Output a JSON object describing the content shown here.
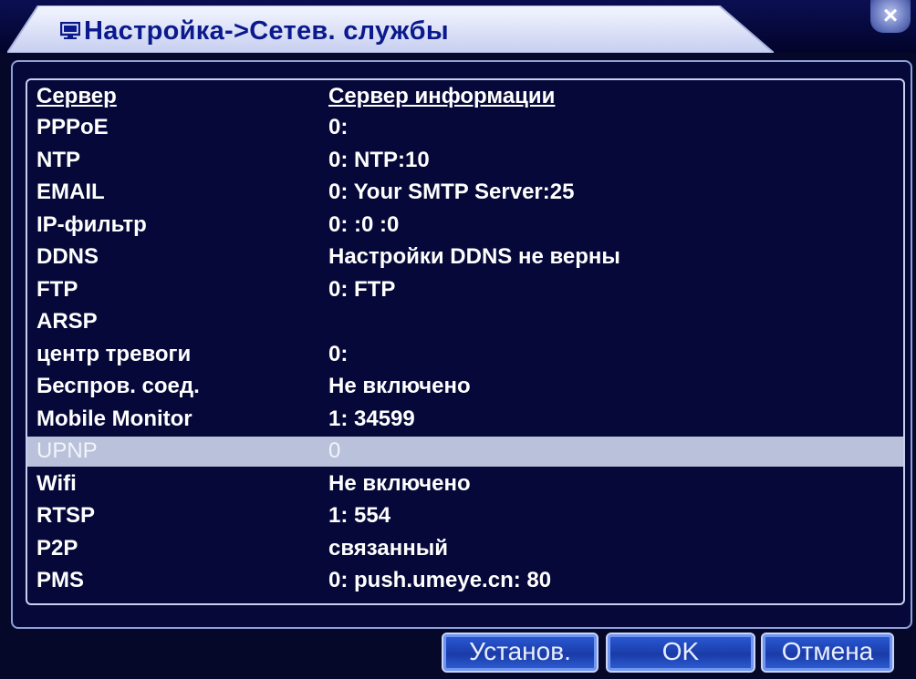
{
  "window": {
    "title": "Настройка->Сетев. службы",
    "close_label": "×"
  },
  "table": {
    "headers": [
      "Сервер",
      "Сервер информации"
    ],
    "rows": [
      {
        "server": "PPPoE",
        "info": "0:"
      },
      {
        "server": "NTP",
        "info": "0: NTP:10"
      },
      {
        "server": "EMAIL",
        "info": "0: Your SMTP Server:25"
      },
      {
        "server": "IP-фильтр",
        "info": "0: :0 :0"
      },
      {
        "server": "DDNS",
        "info": "Настройки DDNS не верны"
      },
      {
        "server": "FTP",
        "info": "0: FTP"
      },
      {
        "server": "ARSP",
        "info": ""
      },
      {
        "server": "центр тревоги",
        "info": "0:"
      },
      {
        "server": "Беспров. соед.",
        "info": "Не включено"
      },
      {
        "server": "Mobile Monitor",
        "info": "1: 34599"
      },
      {
        "server": "UPNP",
        "info": "0",
        "selected": true
      },
      {
        "server": "Wifi",
        "info": "Не включено"
      },
      {
        "server": "RTSP",
        "info": "1: 554"
      },
      {
        "server": "P2P",
        "info": "связанный"
      },
      {
        "server": "PMS",
        "info": "0: push.umeye.cn: 80"
      }
    ]
  },
  "buttons": {
    "set_label": "Установ.",
    "ok_label": "OK",
    "cancel_label": "Отмена"
  },
  "colors": {
    "background": "#06082a",
    "selected_row": "#b9c2da",
    "button": "#2b5cd8"
  }
}
